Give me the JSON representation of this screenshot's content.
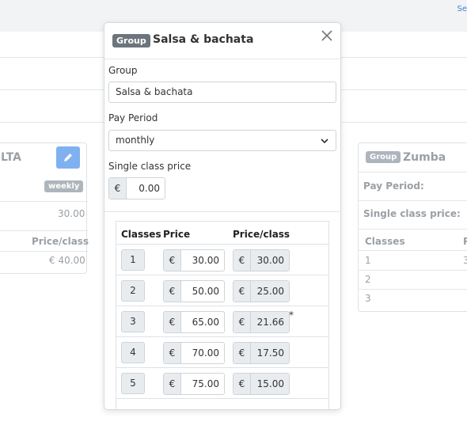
{
  "header": {
    "link_fragment": "Se"
  },
  "left_card": {
    "title_fragment": "LTA",
    "edit_icon": "pencil-icon",
    "period_badge": "weekly",
    "single_price": "30.00",
    "col_price_per_class": "Price/class",
    "row_price_per_class": "€ 40.00"
  },
  "right_card": {
    "badge": "Group",
    "title": "Zumba",
    "pay_period_label": "Pay Period:",
    "single_price_label": "Single class price:",
    "col_classes": "Classes",
    "col_price_fragment": "P",
    "rows": [
      "1",
      "2",
      "3"
    ],
    "row1_price_fragment": "3"
  },
  "modal": {
    "badge": "Group",
    "title": "Salsa & bachata",
    "close_icon": "close-icon",
    "group_label": "Group",
    "group_value": "Salsa & bachata",
    "pay_period_label": "Pay Period",
    "pay_period_value": "monthly",
    "single_price_label": "Single class price",
    "currency": "€",
    "single_price_value": "0.00",
    "table": {
      "headers": {
        "classes": "Classes",
        "price": "Price",
        "price_per_class": "Price/class"
      },
      "rows": [
        {
          "classes": "1",
          "price": "30.00",
          "price_per_class": "30.00",
          "note": ""
        },
        {
          "classes": "2",
          "price": "50.00",
          "price_per_class": "25.00",
          "note": ""
        },
        {
          "classes": "3",
          "price": "65.00",
          "price_per_class": "21.66",
          "note": "*"
        },
        {
          "classes": "4",
          "price": "70.00",
          "price_per_class": "17.50",
          "note": ""
        },
        {
          "classes": "5",
          "price": "75.00",
          "price_per_class": "15.00",
          "note": ""
        }
      ]
    }
  }
}
